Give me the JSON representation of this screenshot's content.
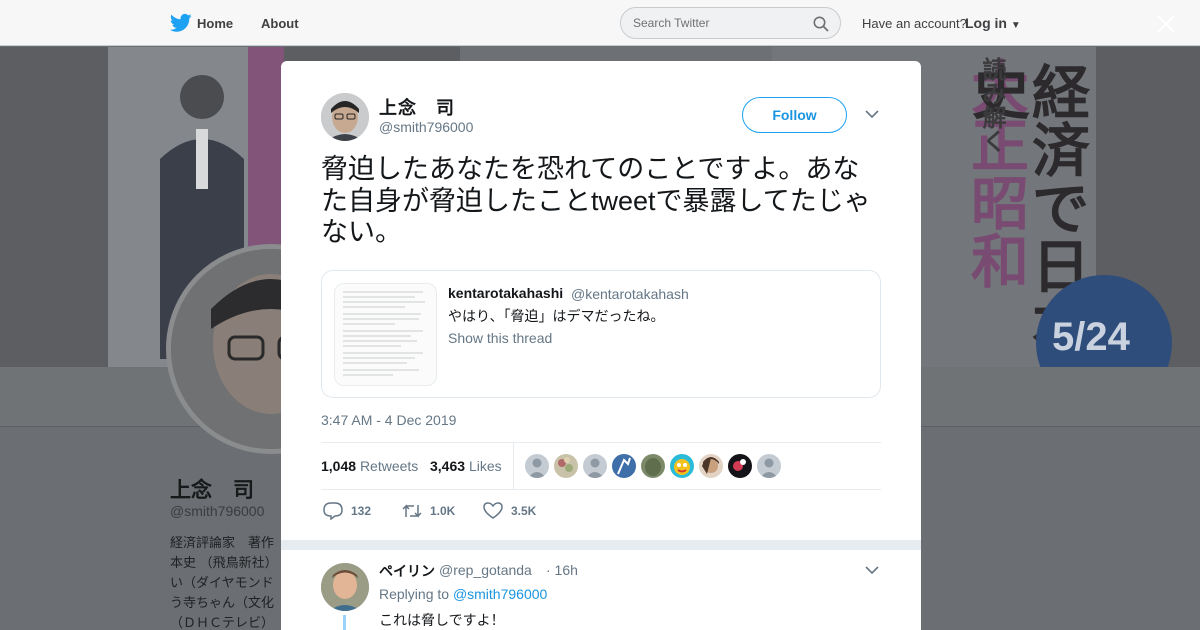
{
  "nav": {
    "home": "Home",
    "about": "About",
    "search_placeholder": "Search Twitter",
    "have_account": "Have an account?",
    "login": "Log in"
  },
  "banner": {
    "title_right": "経済で日本史",
    "title_mid": "大正昭和",
    "subtitle": "読み解く",
    "date_badge": "5/24"
  },
  "profile": {
    "name": "上念　司",
    "handle": "@smith796000",
    "bio": "経済評論家　著作 本史 （飛鳥新社） い（ダイヤモンド う寺ちゃん（文化 （ＤＨＣテレビ）"
  },
  "tweet": {
    "author_name": "上念　司",
    "author_handle": "@smith796000",
    "follow_label": "Follow",
    "text": "脅迫したあなたを恐れてのことですよ。あなた自身が脅迫したことtweetで暴露してたじゃない。",
    "quote": {
      "name": "kentarotakahashi",
      "handle": "@kentarotakahash",
      "text": "やはり、「脅迫」はデマだったね。",
      "show_thread": "Show this thread"
    },
    "timestamp": "3:47 AM - 4 Dec 2019",
    "retweets_count": "1,048",
    "retweets_label": "Retweets",
    "likes_count": "3,463",
    "likes_label": "Likes",
    "actions": {
      "reply_count": "132",
      "retweet_count": "1.0K",
      "like_count": "3.5K"
    }
  },
  "reply": {
    "name": "ペイリン",
    "handle": "@rep_gotanda",
    "time": "· 16h",
    "replying_to_label": "Replying to",
    "replying_to_handle": "@smith796000",
    "text": "これは脅しですよ！"
  },
  "colors": {
    "accent": "#1da1f2",
    "link": "#1b95e0",
    "text": "#14171a",
    "secondary": "#657786"
  }
}
